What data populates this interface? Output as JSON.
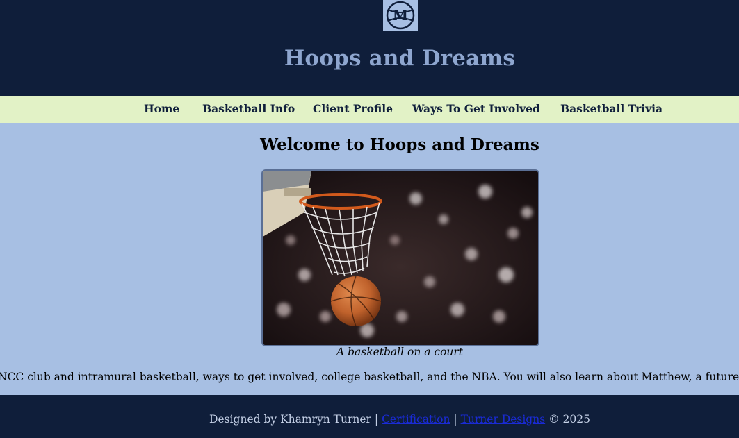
{
  "header": {
    "logo_letter": "M",
    "site_title": "Hoops and Dreams"
  },
  "nav": {
    "items": [
      {
        "label": "Home"
      },
      {
        "label": "Basketball Info"
      },
      {
        "label": "Client Profile"
      },
      {
        "label": "Ways To Get Involved"
      },
      {
        "label": "Basketball Trivia"
      }
    ]
  },
  "main": {
    "heading": "Welcome to Hoops and Dreams",
    "hero_caption": "A basketball on a court",
    "intro_text": "NCC club and intramural basketball, ways to get involved, college basketball, and the NBA. You will also learn about Matthew, a future basketball coach"
  },
  "footer": {
    "designed_by": "Designed by Khamryn Turner",
    "separator": "|",
    "certification_link": "Certification",
    "turner_designs_link": "Turner Designs",
    "copyright": "© 2025"
  },
  "colors": {
    "header_bg": "#0f1e3a",
    "title_color": "#8ea6cf",
    "nav_bg": "#e2f2c6",
    "page_bg": "#a7bfe3",
    "link_color": "#1a2bd6"
  }
}
